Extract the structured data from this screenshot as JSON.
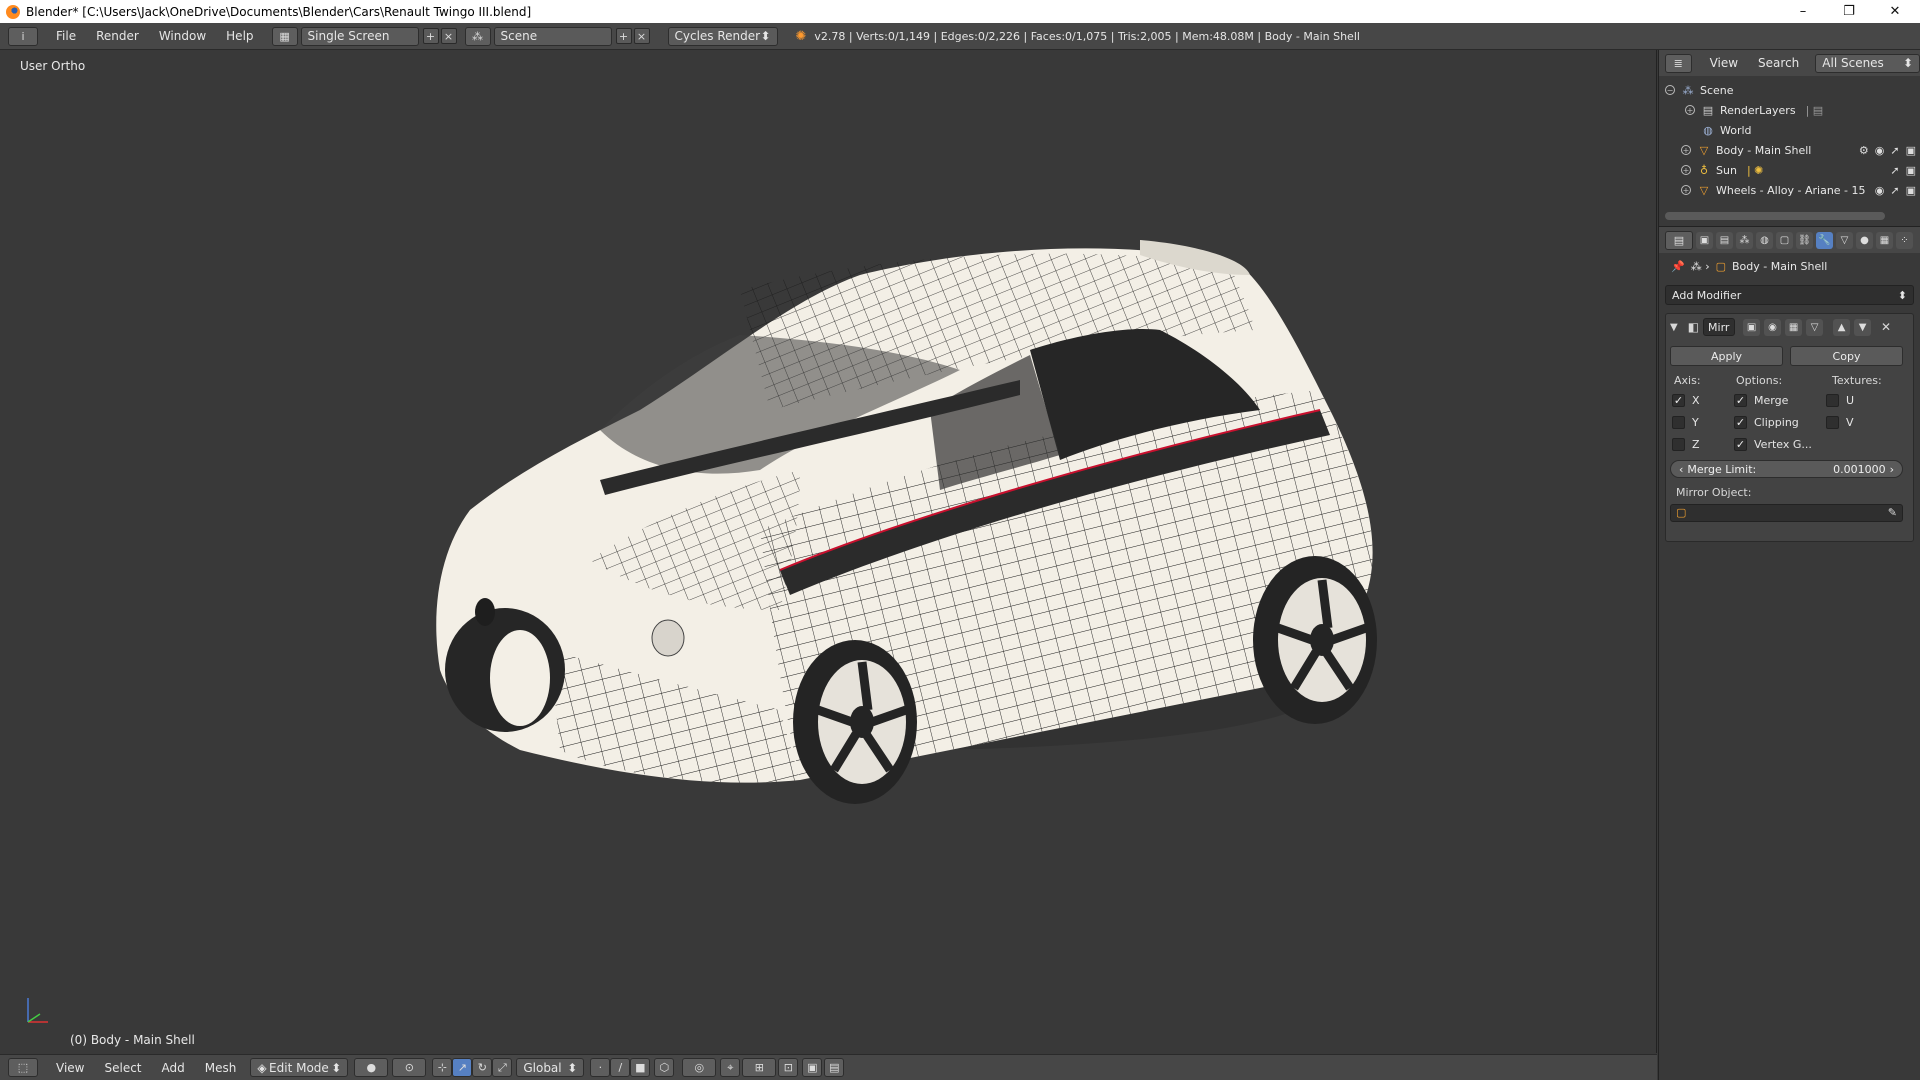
{
  "window": {
    "title": "Blender* [C:\\Users\\Jack\\OneDrive\\Documents\\Blender\\Cars\\Renault Twingo III.blend]",
    "controls": {
      "minimize": "–",
      "maximize": "❐",
      "close": "✕"
    }
  },
  "info_header": {
    "editor_icon": "i",
    "menus": [
      "File",
      "Render",
      "Window",
      "Help"
    ],
    "screen_layout": "Single Screen",
    "scene": "Scene",
    "render_engine": "Cycles Render",
    "stats": "v2.78 | Verts:0/1,149 | Edges:0/2,226 | Faces:0/1,075 | Tris:2,005 | Mem:48.08M | Body - Main Shell"
  },
  "viewport": {
    "view_label": "User Ortho",
    "object_label": "(0) Body - Main Shell"
  },
  "bottom_header": {
    "menus": [
      "View",
      "Select",
      "Add",
      "Mesh"
    ],
    "mode": "Edit Mode",
    "orientation": "Global"
  },
  "outliner": {
    "menus": [
      "View",
      "Search"
    ],
    "display_filter": "All Scenes",
    "rows": [
      {
        "name": "Scene",
        "icon": "scene-icon"
      },
      {
        "name": "RenderLayers",
        "icon": "render-layers-icon"
      },
      {
        "name": "World",
        "icon": "world-icon"
      },
      {
        "name": "Body - Main Shell",
        "icon": "mesh-icon"
      },
      {
        "name": "Sun",
        "icon": "lamp-icon"
      },
      {
        "name": "Wheels - Alloy - Ariane - 15",
        "icon": "mesh-icon"
      }
    ]
  },
  "properties": {
    "object_name": "Body - Main Shell",
    "add_modifier": "Add Modifier",
    "modifier": {
      "name": "Mirr",
      "apply": "Apply",
      "copy": "Copy",
      "axis_label": "Axis:",
      "options_label": "Options:",
      "textures_label": "Textures:",
      "axis": [
        {
          "label": "X",
          "checked": true
        },
        {
          "label": "Y",
          "checked": false
        },
        {
          "label": "Z",
          "checked": false
        }
      ],
      "options": [
        {
          "label": "Merge",
          "checked": true
        },
        {
          "label": "Clipping",
          "checked": true
        },
        {
          "label": "Vertex G...",
          "checked": true
        }
      ],
      "textures": [
        {
          "label": "U",
          "checked": false
        },
        {
          "label": "V",
          "checked": false
        }
      ],
      "merge_limit_label": "Merge Limit:",
      "merge_limit_value": "0.001000",
      "mirror_object_label": "Mirror Object:"
    }
  },
  "colors": {
    "header": "#474747",
    "background": "#393939",
    "accent": "#5680c2",
    "car_body": "#f3efe6",
    "stripe": "#2b2b2b",
    "stripe_edge": "#c8102e"
  }
}
